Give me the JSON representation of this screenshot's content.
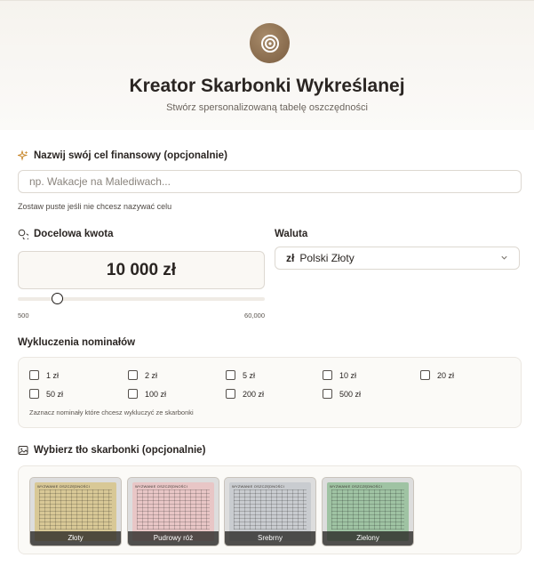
{
  "header": {
    "title": "Kreator Skarbonki Wykreślanej",
    "subtitle": "Stwórz spersonalizowaną tabelę oszczędności"
  },
  "goal": {
    "label": "Nazwij swój cel finansowy (opcjonalnie)",
    "placeholder": "np. Wakacje na Malediwach...",
    "value": "",
    "hint": "Zostaw puste jeśli nie chcesz nazywać celu"
  },
  "amount": {
    "label": "Docelowa kwota",
    "value_display": "10 000 zł",
    "value": 10000,
    "min_label": "500",
    "max_label": "60,000",
    "min": 500,
    "max": 60000
  },
  "currency": {
    "label": "Waluta",
    "symbol": "zł",
    "selected": "Polski Złoty"
  },
  "exclusions": {
    "label": "Wykluczenia nominałów",
    "options": [
      "1 zł",
      "2 zł",
      "5 zł",
      "10 zł",
      "20 zł",
      "50 zł",
      "100 zł",
      "200 zł",
      "500 zł"
    ],
    "checked": [
      false,
      false,
      false,
      false,
      false,
      false,
      false,
      false,
      false
    ],
    "note": "Zaznacz nominały które chcesz wykluczyć ze skarbonki"
  },
  "background": {
    "label": "Wybierz tło skarbonki (opcjonalnie)",
    "options": [
      {
        "name": "Złoty",
        "color": "#d8c896"
      },
      {
        "name": "Pudrowy róż",
        "color": "#e8c6c6"
      },
      {
        "name": "Srebrny",
        "color": "#c9ccd0"
      },
      {
        "name": "Zielony",
        "color": "#9fc3a3"
      }
    ],
    "card_header": "WYZWANIE OSZCZĘDNOŚCI"
  },
  "colors": {
    "accent": "#8b6d4e",
    "border": "#ddd8d1"
  }
}
